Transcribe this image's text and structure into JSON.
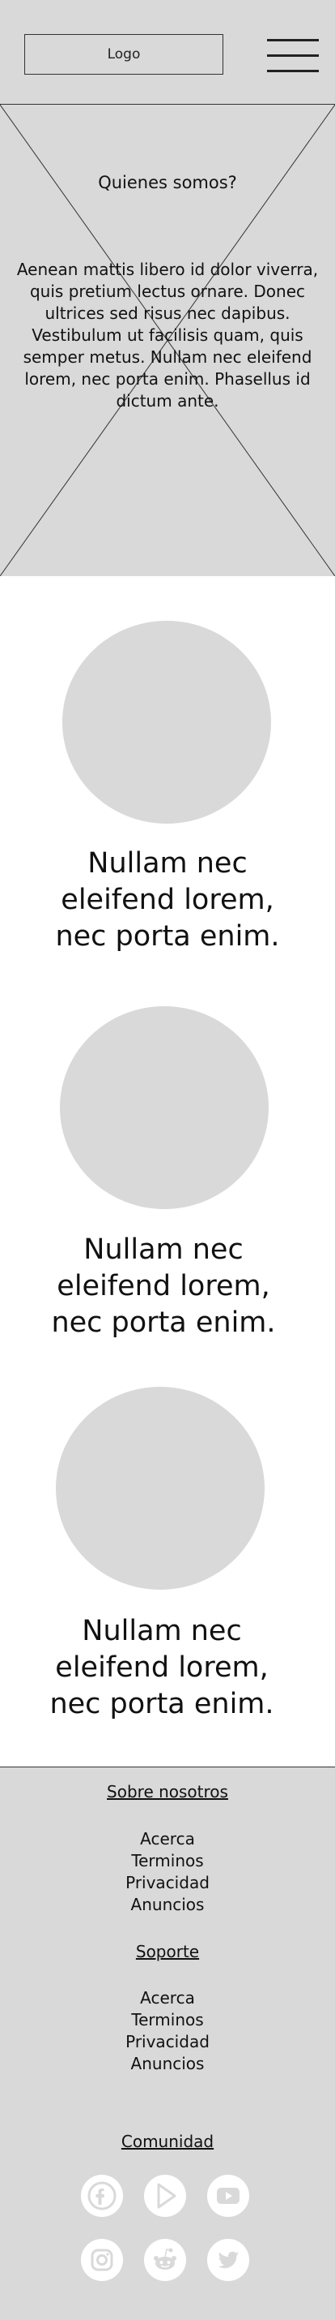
{
  "header": {
    "logo_label": "Logo",
    "menu_icon": "hamburger-menu-icon"
  },
  "hero": {
    "title": "Quienes somos?",
    "text_lines": [
      "Aenean mattis libero id dolor viverra,",
      "quis pretium lectus ornare. Donec",
      "ultrices sed risus nec dapibus.",
      "Vestibulum ut facilisis quam, quis",
      "semper metus. Nullam nec eleifend",
      "lorem, nec porta enim. Phasellus id",
      "dictum ante."
    ],
    "image_placeholder": "image-placeholder-icon"
  },
  "features": [
    {
      "lines": [
        "Nullam nec",
        "eleifend lorem,",
        "nec porta enim."
      ]
    },
    {
      "lines": [
        "Nullam nec",
        "eleifend lorem,",
        "nec porta enim."
      ]
    },
    {
      "lines": [
        "Nullam nec",
        "eleifend lorem,",
        "nec porta enim."
      ]
    }
  ],
  "footer": {
    "about": {
      "heading": "Sobre nosotros",
      "links": [
        "Acerca",
        "Terminos",
        "Privacidad",
        "Anuncios"
      ]
    },
    "support": {
      "heading": "Soporte",
      "links": [
        "Acerca",
        "Terminos",
        "Privacidad",
        "Anuncios"
      ]
    },
    "community": {
      "heading": "Comunidad",
      "icons": [
        "facebook-icon",
        "google-play-icon",
        "youtube-icon",
        "instagram-icon",
        "reddit-icon",
        "twitter-icon"
      ]
    }
  },
  "colors": {
    "placeholder_gray": "#d9d9d9",
    "line": "#333333",
    "text": "#111111",
    "icon": "#d9d9d9"
  }
}
